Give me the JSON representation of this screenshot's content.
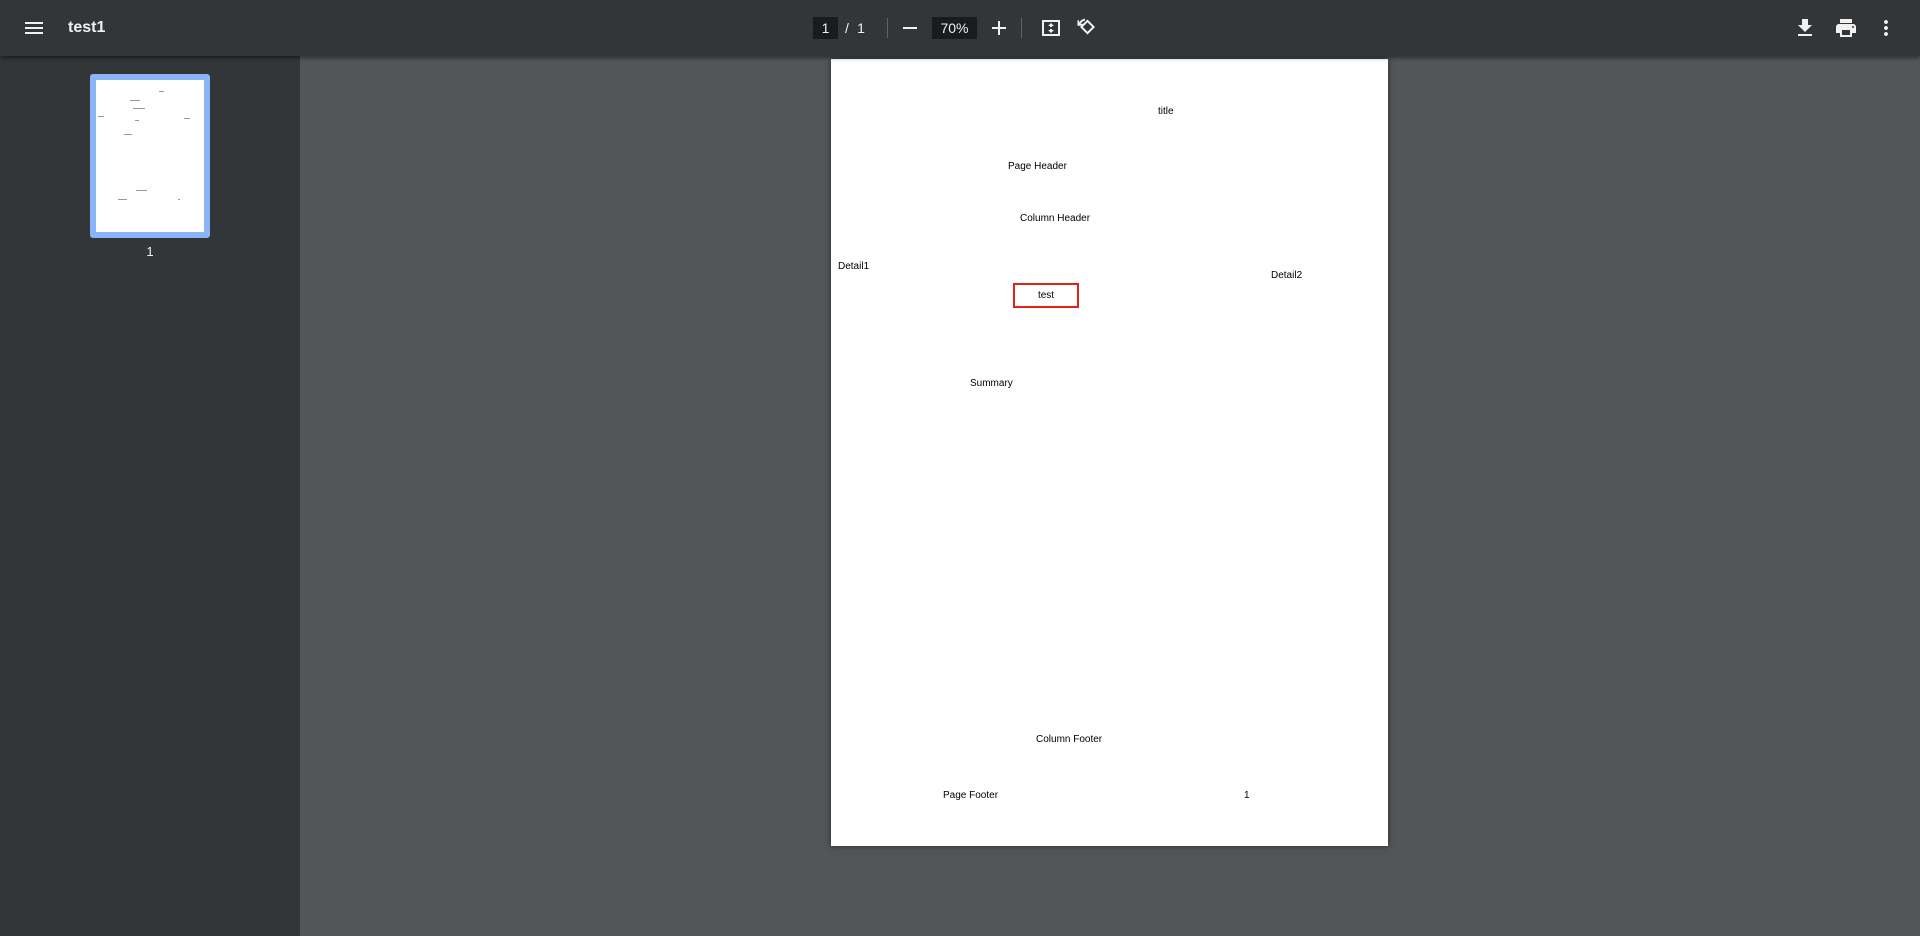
{
  "toolbar": {
    "menu_icon": "menu-icon",
    "title": "test1",
    "page_current": "1",
    "page_separator": "/",
    "page_total": "1",
    "zoom_out_icon": "minus-icon",
    "zoom_value": "70%",
    "zoom_in_icon": "plus-icon",
    "fit_icon": "fit-to-page-icon",
    "rotate_icon": "rotate-icon",
    "download_icon": "download-icon",
    "print_icon": "print-icon",
    "more_icon": "more-vert-icon"
  },
  "sidebar": {
    "thumbnails": [
      {
        "page_number": "1",
        "selected": true
      }
    ]
  },
  "document": {
    "title": "title",
    "page_header": "Page Header",
    "column_header": "Column Header",
    "detail1": "Detail1",
    "detail2": "Detail2",
    "test_field": "test",
    "summary": "Summary",
    "column_footer": "Column Footer",
    "page_footer": "Page Footer",
    "page_number": "1"
  },
  "colors": {
    "toolbar_bg": "#323639",
    "viewer_bg": "#525659",
    "thumbnail_selected": "#8ab4f8",
    "test_box_border": "#e2231a"
  }
}
